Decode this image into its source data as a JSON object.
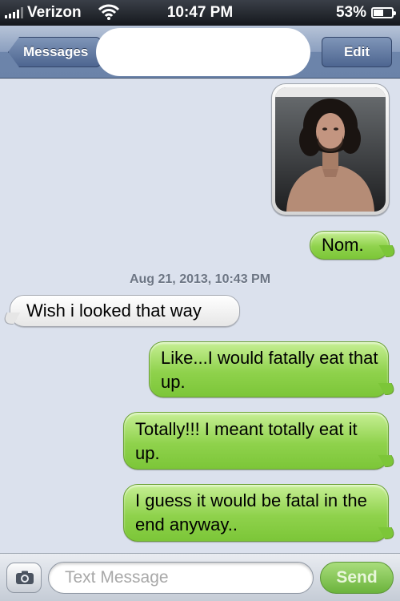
{
  "status_bar": {
    "carrier": "Verizon",
    "time": "10:47 PM",
    "battery_percent": "53%",
    "battery_level": 0.53,
    "icons": [
      "signal-icon",
      "wifi-icon",
      "battery-icon"
    ]
  },
  "nav": {
    "back_label": "Messages",
    "edit_label": "Edit"
  },
  "messages": {
    "photo": {
      "type": "image",
      "direction": "sent",
      "description_icon": "photo-attachment"
    },
    "nom": "Nom.",
    "timestamp": "Aug 21, 2013, 10:43 PM",
    "wish": "Wish i looked that way",
    "like": "Like...I would fatally eat that up.",
    "totally": "Totally!!! I meant totally eat it up.",
    "guess": "I guess it would be fatal in the end anyway.."
  },
  "input_bar": {
    "placeholder": "Text Message",
    "send_label": "Send"
  },
  "colors": {
    "sent_bubble": "#8fd24c",
    "received_bubble": "#ffffff",
    "background": "#dbe1ed",
    "nav_bar": "#6d85ab"
  }
}
